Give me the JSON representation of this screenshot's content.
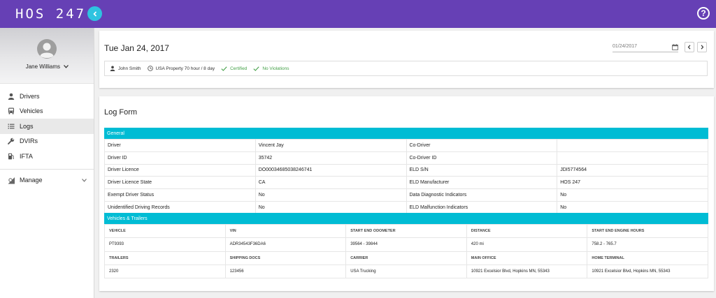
{
  "app": {
    "logo": "HOS 247"
  },
  "profile": {
    "name": "Jane Williams"
  },
  "sidebar": {
    "items": [
      {
        "label": "Drivers",
        "icon": "person-icon"
      },
      {
        "label": "Vehicles",
        "icon": "bus-icon"
      },
      {
        "label": "Logs",
        "icon": "list-icon",
        "active": true
      },
      {
        "label": "DVIRs",
        "icon": "wrench-icon"
      },
      {
        "label": "IFTA",
        "icon": "fuel-icon"
      }
    ],
    "manage": {
      "label": "Manage",
      "icon": "manage-icon"
    }
  },
  "header": {
    "date_title": "Tue Jan 24, 2017",
    "date_input": "01/24/2017",
    "status": {
      "driver": "John Smith",
      "ruleset": "USA Property 70 hour / 8 day",
      "certified": "Certified",
      "violations": "No Violations"
    }
  },
  "colors": {
    "topbar": "#6640b5",
    "accent": "#00bcd4",
    "collapse": "#2ec3e0",
    "ok": "#43a047"
  },
  "logform": {
    "title": "Log Form",
    "general_heading": "General",
    "general_rows": [
      [
        "Driver",
        "Vincent Jay",
        "Co-Driver",
        ""
      ],
      [
        "Driver ID",
        "35742",
        "Co-Driver ID",
        ""
      ],
      [
        "Driver Licence",
        "DO00034685038246741",
        "ELD S/N",
        "JDI5774564"
      ],
      [
        "Driver Licence State",
        "CA",
        "ELD Manufacturer",
        "HOS 247"
      ],
      [
        "Exempt Driver Status",
        "No",
        "Data Diagnostic Indicators",
        "No"
      ],
      [
        "Unidentified Driving Records",
        "No",
        "ELD Malfunction Indicators",
        "No"
      ]
    ],
    "vehicles_heading": "Vehicles & Trailers",
    "vehicle_headers": [
      "VEHICLE",
      "VIN",
      "START END ODOMETER",
      "DISTANCE",
      "START END ENGINE HOURS"
    ],
    "vehicle_values": [
      "PT9393",
      "ADR34543F36DA6",
      "39564 - 39844",
      "420 mi",
      "758.2 - 765.7"
    ],
    "trailer_headers": [
      "TRAILERS",
      "SHIPPING DOCS",
      "CARRIER",
      "MAIN OFFICE",
      "HOME TERMINAL"
    ],
    "trailer_values": [
      "2320",
      "123456",
      "USA Trucking",
      "10921 Excelsior Blvd, Hopkins MN, 55343",
      "10921 Excelsior Blvd, Hopkins MN, 55343"
    ]
  }
}
